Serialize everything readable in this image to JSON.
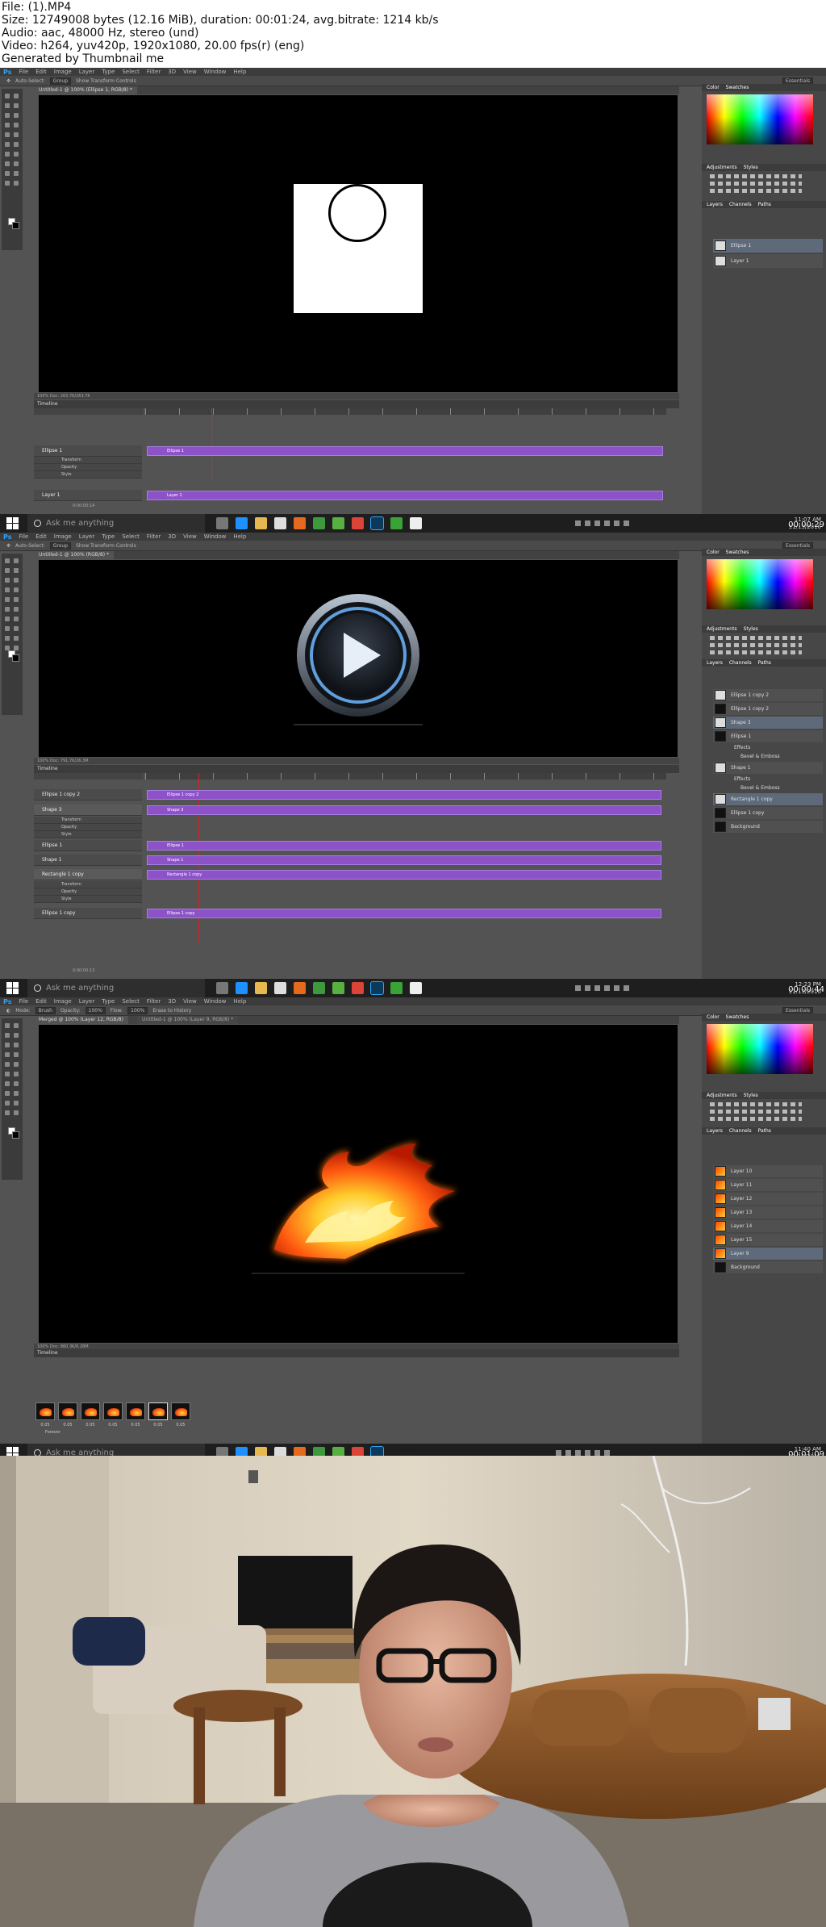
{
  "header": {
    "file": "File: (1).MP4",
    "size": "Size: 12749008 bytes (12.16 MiB), duration: 00:01:24, avg.bitrate: 1214 kb/s",
    "audio": "Audio: aac, 48000 Hz, stereo (und)",
    "video": "Video: h264, yuv420p, 1920x1080, 20.00 fps(r) (eng)",
    "generator": "Generated by Thumbnail me"
  },
  "menu": [
    "File",
    "Edit",
    "Image",
    "Layer",
    "Type",
    "Select",
    "Filter",
    "3D",
    "View",
    "Window",
    "Help"
  ],
  "app_logo": "Ps",
  "frames": [
    {
      "timestamp": "00:00:29",
      "tray_time": "11:07 AM",
      "tray_date": "11/13/2016",
      "options": [
        "Auto-Select:",
        "Group",
        "Show Transform Controls"
      ],
      "workspace": "Essentials",
      "doc_tab": "Untitled-1 @ 100% (Ellipse 1, RGB/8) *",
      "status": "100%     Doc: 263.7K/263.7K",
      "timeline_label": "Timeline",
      "ruler": [
        "00",
        "05f",
        "10f",
        "15f",
        "01:00f",
        "05f",
        "10f",
        "15f",
        "02:00f",
        "05f",
        "10f",
        "15f",
        "03:00f",
        "05f",
        "10f",
        "15f",
        "04:00f",
        "05f",
        "10f",
        "15f",
        "05:0"
      ],
      "layers_panel": [
        "Ellipse 1",
        "Layer 1"
      ],
      "tracks": [
        {
          "name": "Ellipse 1",
          "clip": "Ellipse 1",
          "subs": [
            "Transform",
            "Opacity",
            "Style"
          ]
        },
        {
          "name": "Layer 1",
          "clip": "Layer 1",
          "subs": []
        }
      ],
      "timecode": "0:00:00:14"
    },
    {
      "timestamp": "00:00:44",
      "tray_time": "12:23 PM",
      "tray_date": "11/13/2016",
      "options": [
        "Auto-Select:",
        "Group",
        "Show Transform Controls"
      ],
      "workspace": "Essentials",
      "doc_tab": "Untitled-1 @ 100% (RGB/8) *",
      "status": "100%     Doc: 791.7K/26.3M",
      "timeline_label": "Timeline",
      "layers_panel": [
        "Ellipse 1 copy 2",
        "Ellipse 1 copy 2",
        "Shape 3",
        "Ellipse 1",
        "Effects",
        "Bevel & Emboss",
        "Shape 1",
        "Effects",
        "Bevel & Emboss",
        "Rectangle 1 copy",
        "Ellipse 1 copy",
        "Background"
      ],
      "tracks": [
        {
          "name": "Ellipse 1 copy 2",
          "clip": "Ellipse 1 copy 2",
          "subs": []
        },
        {
          "name": "Shape 3",
          "clip": "Shape 3",
          "subs": [
            "Transform",
            "Opacity",
            "Style"
          ]
        },
        {
          "name": "Ellipse 1",
          "clip": "Ellipse 1",
          "subs": []
        },
        {
          "name": "Shape 1",
          "clip": "Shape 1",
          "subs": []
        },
        {
          "name": "Rectangle 1 copy",
          "clip": "Rectangle 1 copy",
          "subs": [
            "Transform",
            "Opacity",
            "Style"
          ]
        },
        {
          "name": "Ellipse 1 copy",
          "clip": "Ellipse 1 copy",
          "subs": []
        }
      ],
      "timecode": "0:00:00:13"
    },
    {
      "timestamp": "00:01:09",
      "tray_time": "11:40 AM",
      "tray_date": "11/13/2016",
      "options": [
        "Mode:",
        "Brush",
        "Opacity:",
        "100%",
        "Flow:",
        "100%",
        "Erase to History"
      ],
      "workspace": "Essentials",
      "doc_tab": "Merged @ 100% (Layer 12, RGB/8)",
      "doc_tab2": "Untitled-1 @ 100% (Layer 9, RGB/8) *",
      "status": "100%     Doc: 860.3K/6.28M",
      "timeline_label": "Timeline",
      "layers_panel": [
        "Layer 10",
        "Layer 11",
        "Layer 12",
        "Layer 13",
        "Layer 14",
        "Layer 15",
        "Layer 9",
        "Background"
      ],
      "frame_delays": [
        "0.05",
        "0.05",
        "0.05",
        "0.05",
        "0.05",
        "0.05",
        "0.05"
      ],
      "loop": "Forever"
    }
  ],
  "taskbar": {
    "search_placeholder": "Ask me anything"
  },
  "colors": {
    "accent": "#2fa3f7",
    "clip": "#8d52c8",
    "ui": "#535353"
  }
}
